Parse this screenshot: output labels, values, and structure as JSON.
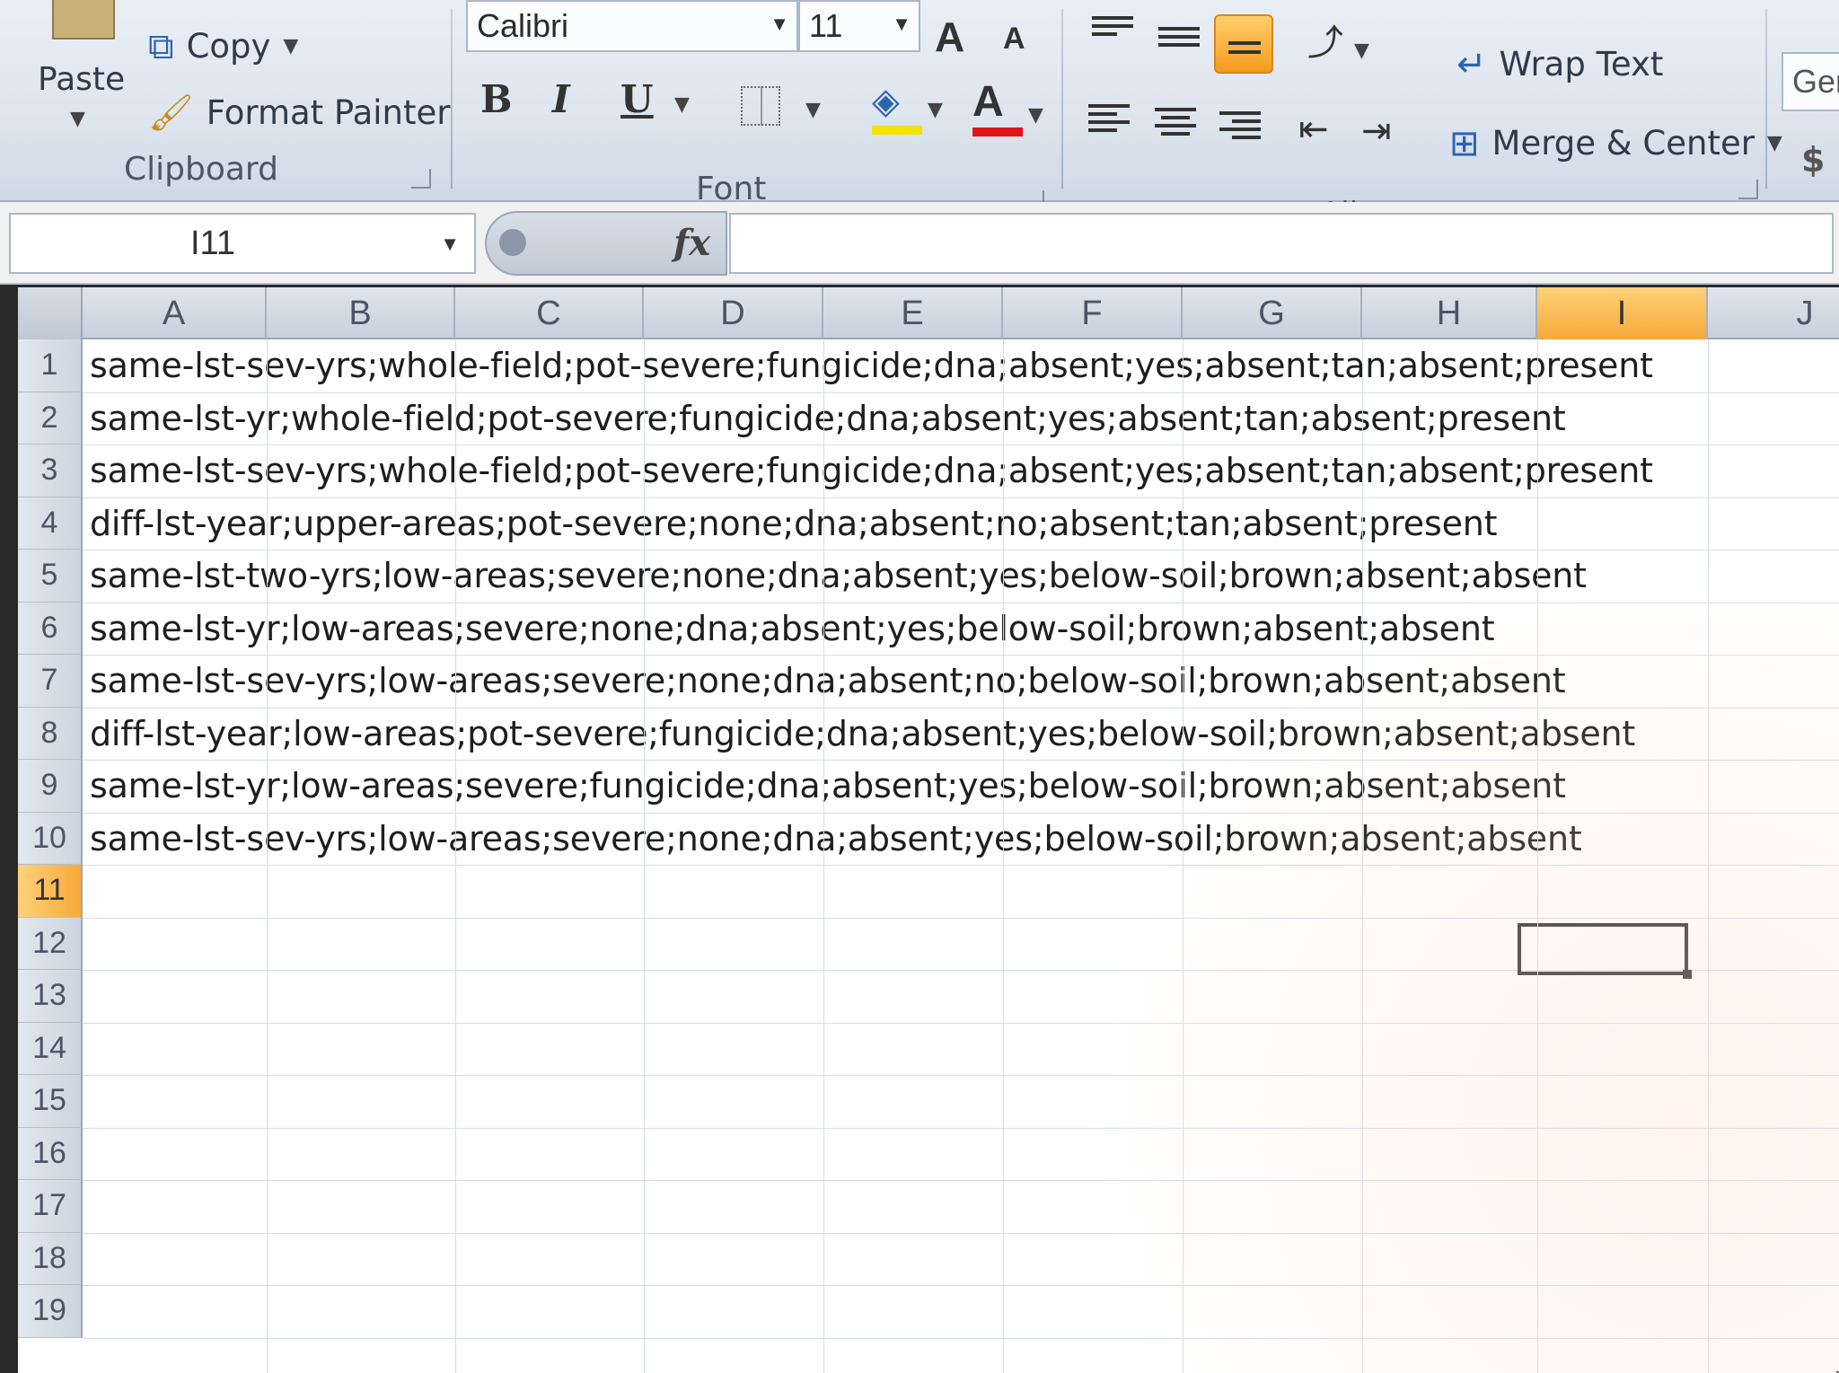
{
  "ribbon": {
    "clipboard": {
      "paste_label": "Paste",
      "copy_label": "Copy",
      "format_painter_label": "Format Painter",
      "group_label": "Clipboard"
    },
    "font": {
      "font_name": "Calibri",
      "font_size": "11",
      "bold": "B",
      "italic": "I",
      "underline": "U",
      "font_color_letter": "A",
      "grow_letter": "A",
      "shrink_letter": "A",
      "group_label": "Font"
    },
    "alignment": {
      "wrap_text_label": "Wrap Text",
      "merge_center_label": "Merge & Center",
      "group_label": "Alignment"
    },
    "number": {
      "format_partial": "Ger",
      "currency_symbol": "$"
    }
  },
  "formula_bar": {
    "name_box": "I11",
    "fx_label": "fx",
    "formula": ""
  },
  "grid": {
    "columns": [
      "A",
      "B",
      "C",
      "D",
      "E",
      "F",
      "G",
      "H",
      "I",
      "J"
    ],
    "active_column": "I",
    "active_row": "11",
    "row_numbers": [
      "1",
      "2",
      "3",
      "4",
      "5",
      "6",
      "7",
      "8",
      "9",
      "10",
      "11",
      "12",
      "13",
      "14",
      "15",
      "16",
      "17",
      "18",
      "19"
    ],
    "rows": [
      "same-lst-sev-yrs;whole-field;pot-severe;fungicide;dna;absent;yes;absent;tan;absent;present",
      "same-lst-yr;whole-field;pot-severe;fungicide;dna;absent;yes;absent;tan;absent;present",
      "same-lst-sev-yrs;whole-field;pot-severe;fungicide;dna;absent;yes;absent;tan;absent;present",
      "diff-lst-year;upper-areas;pot-severe;none;dna;absent;no;absent;tan;absent;present",
      "same-lst-two-yrs;low-areas;severe;none;dna;absent;yes;below-soil;brown;absent;absent",
      "same-lst-yr;low-areas;severe;none;dna;absent;yes;below-soil;brown;absent;absent",
      "same-lst-sev-yrs;low-areas;severe;none;dna;absent;no;below-soil;brown;absent;absent",
      "diff-lst-year;low-areas;pot-severe;fungicide;dna;absent;yes;below-soil;brown;absent;absent",
      "same-lst-yr;low-areas;severe;fungicide;dna;absent;yes;below-soil;brown;absent;absent",
      "same-lst-sev-yrs;low-areas;severe;none;dna;absent;yes;below-soil;brown;absent;absent"
    ]
  },
  "colors": {
    "accent_orange": "#f7a93a",
    "ribbon_bg": "#e3e9f1",
    "header_bg": "#c6d0dc"
  }
}
